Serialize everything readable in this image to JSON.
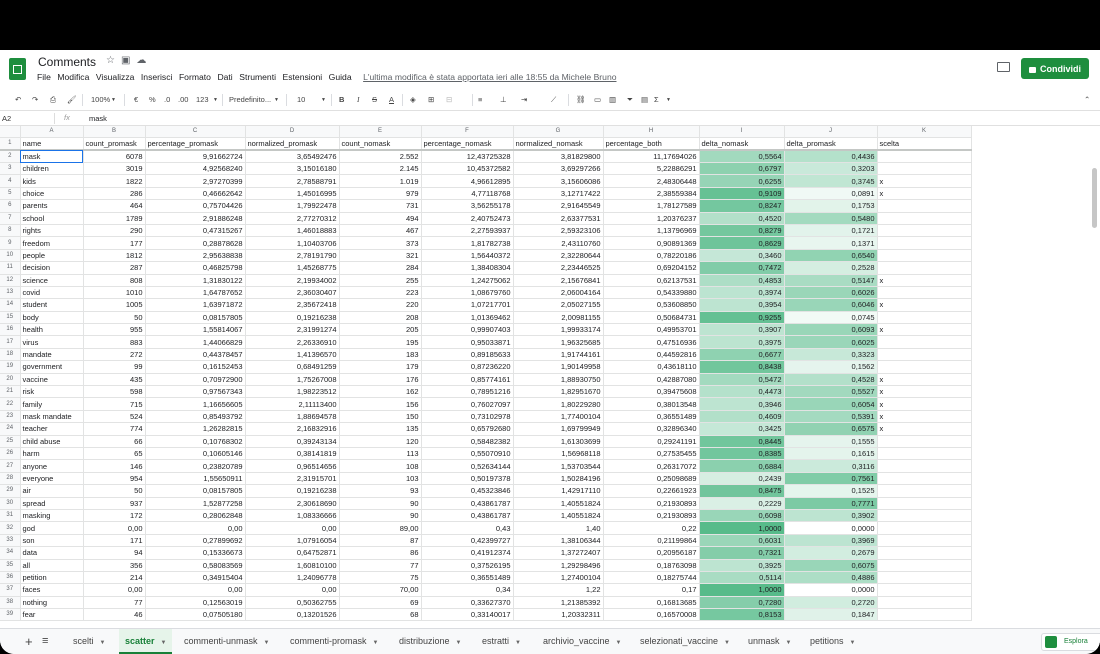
{
  "header": {
    "title": "Comments",
    "menus": [
      "File",
      "Modifica",
      "Visualizza",
      "Inserisci",
      "Formato",
      "Dati",
      "Strumenti",
      "Estensioni",
      "Guida"
    ],
    "last_edit": "L'ultima modifica è stata apportata ieri alle 18:55 da Michele Bruno",
    "share_label": "Condividi"
  },
  "toolbar": {
    "zoom": "100%",
    "currency": "€",
    "percent": "%",
    "dec_less": ".0",
    "dec_more": ".00",
    "format_more": "123",
    "font": "Predefinito...",
    "font_size": "10",
    "bold": "B",
    "italic": "I",
    "strike": "S",
    "text_color": "A",
    "sum": "Σ"
  },
  "formula_bar": {
    "cell_ref": "A2",
    "fx": "fx",
    "value": "mask"
  },
  "columns": [
    "",
    "A",
    "B",
    "C",
    "D",
    "E",
    "F",
    "G",
    "H",
    "I",
    "J",
    "K"
  ],
  "rows": [
    [
      "name",
      "count_promask",
      "percentage_promask",
      "normalized_promask",
      "count_nomask",
      "percentage_nomask",
      "normalized_nomask",
      "percentage_both",
      "delta_nomask",
      "delta_promask",
      "scelta"
    ],
    [
      "mask",
      "6078",
      "9,91662724",
      "3,65492476",
      "2.552",
      "12,43725328",
      "3,81829800",
      "11,17694026",
      "0,5564",
      "0,4436",
      ""
    ],
    [
      "children",
      "3019",
      "4,92568240",
      "3,15016180",
      "2.145",
      "10,45372582",
      "3,69297266",
      "5,22886291",
      "0,6797",
      "0,3203",
      ""
    ],
    [
      "kids",
      "1822",
      "2,97270399",
      "2,78588791",
      "1.019",
      "4,96612895",
      "3,15606086",
      "2,48306448",
      "0,6255",
      "0,3745",
      "x"
    ],
    [
      "choice",
      "286",
      "0,46662642",
      "1,45016995",
      "979",
      "4,77118768",
      "3,12717422",
      "2,38559384",
      "0,9109",
      "0,0891",
      "x"
    ],
    [
      "parents",
      "464",
      "0,75704426",
      "1,79922478",
      "731",
      "3,56255178",
      "2,91645549",
      "1,78127589",
      "0,8247",
      "0,1753",
      ""
    ],
    [
      "school",
      "1789",
      "2,91886248",
      "2,77270312",
      "494",
      "2,40752473",
      "2,63377531",
      "1,20376237",
      "0,4520",
      "0,5480",
      ""
    ],
    [
      "rights",
      "290",
      "0,47315267",
      "1,46018883",
      "467",
      "2,27593937",
      "2,59323106",
      "1,13796969",
      "0,8279",
      "0,1721",
      ""
    ],
    [
      "freedom",
      "177",
      "0,28878628",
      "1,10403706",
      "373",
      "1,81782738",
      "2,43110760",
      "0,90891369",
      "0,8629",
      "0,1371",
      ""
    ],
    [
      "people",
      "1812",
      "2,95638838",
      "2,78191790",
      "321",
      "1,56440372",
      "2,32280644",
      "0,78220186",
      "0,3460",
      "0,6540",
      ""
    ],
    [
      "decision",
      "287",
      "0,46825798",
      "1,45268775",
      "284",
      "1,38408304",
      "2,23446525",
      "0,69204152",
      "0,7472",
      "0,2528",
      ""
    ],
    [
      "science",
      "808",
      "1,31830122",
      "2,19934002",
      "255",
      "1,24275062",
      "2,15676841",
      "0,62137531",
      "0,4853",
      "0,5147",
      "x"
    ],
    [
      "covid",
      "1010",
      "1,64787652",
      "2,36030407",
      "223",
      "1,08679760",
      "2,06004164",
      "0,54339880",
      "0,3974",
      "0,6026",
      ""
    ],
    [
      "student",
      "1005",
      "1,63971872",
      "2,35672418",
      "220",
      "1,07217701",
      "2,05027155",
      "0,53608850",
      "0,3954",
      "0,6046",
      "x"
    ],
    [
      "body",
      "50",
      "0,08157805",
      "0,19216238",
      "208",
      "1,01369462",
      "2,00981155",
      "0,50684731",
      "0,9255",
      "0,0745",
      ""
    ],
    [
      "health",
      "955",
      "1,55814067",
      "2,31991274",
      "205",
      "0,99907403",
      "1,99933174",
      "0,49953701",
      "0,3907",
      "0,6093",
      "x"
    ],
    [
      "virus",
      "883",
      "1,44066829",
      "2,26336910",
      "195",
      "0,95033871",
      "1,96325685",
      "0,47516936",
      "0,3975",
      "0,6025",
      ""
    ],
    [
      "mandate",
      "272",
      "0,44378457",
      "1,41396570",
      "183",
      "0,89185633",
      "1,91744161",
      "0,44592816",
      "0,6677",
      "0,3323",
      ""
    ],
    [
      "government",
      "99",
      "0,16152453",
      "0,68491259",
      "179",
      "0,87236220",
      "1,90149958",
      "0,43618110",
      "0,8438",
      "0,1562",
      ""
    ],
    [
      "vaccine",
      "435",
      "0,70972900",
      "1,75267008",
      "176",
      "0,85774161",
      "1,88930750",
      "0,42887080",
      "0,5472",
      "0,4528",
      "x"
    ],
    [
      "risk",
      "598",
      "0,97567343",
      "1,98223512",
      "162",
      "0,78951216",
      "1,82951670",
      "0,39475608",
      "0,4473",
      "0,5527",
      "x"
    ],
    [
      "family",
      "715",
      "1,16656605",
      "2,11113400",
      "156",
      "0,76027097",
      "1,80229280",
      "0,38013548",
      "0,3946",
      "0,6054",
      "x"
    ],
    [
      "mask mandate",
      "524",
      "0,85493792",
      "1,88694578",
      "150",
      "0,73102978",
      "1,77400104",
      "0,36551489",
      "0,4609",
      "0,5391",
      "x"
    ],
    [
      "teacher",
      "774",
      "1,26282815",
      "2,16832916",
      "135",
      "0,65792680",
      "1,69799949",
      "0,32896340",
      "0,3425",
      "0,6575",
      "x"
    ],
    [
      "child abuse",
      "66",
      "0,10768302",
      "0,39243134",
      "120",
      "0,58482382",
      "1,61303699",
      "0,29241191",
      "0,8445",
      "0,1555",
      ""
    ],
    [
      "harm",
      "65",
      "0,10605146",
      "0,38141819",
      "113",
      "0,55070910",
      "1,56968118",
      "0,27535455",
      "0,8385",
      "0,1615",
      ""
    ],
    [
      "anyone",
      "146",
      "0,23820789",
      "0,96514656",
      "108",
      "0,52634144",
      "1,53703544",
      "0,26317072",
      "0,6884",
      "0,3116",
      ""
    ],
    [
      "everyone",
      "954",
      "1,55650911",
      "2,31915701",
      "103",
      "0,50197378",
      "1,50284196",
      "0,25098689",
      "0,2439",
      "0,7561",
      ""
    ],
    [
      "air",
      "50",
      "0,08157805",
      "0,19216238",
      "93",
      "0,45323846",
      "1,42917110",
      "0,22661923",
      "0,8475",
      "0,1525",
      ""
    ],
    [
      "spread",
      "937",
      "1,52877258",
      "2,30618690",
      "90",
      "0,43861787",
      "1,40551824",
      "0,21930893",
      "0,2229",
      "0,7771",
      ""
    ],
    [
      "masking",
      "172",
      "0,28062848",
      "1,08336666",
      "90",
      "0,43861787",
      "1,40551824",
      "0,21930893",
      "0,6098",
      "0,3902",
      ""
    ],
    [
      "god",
      "0,00",
      "0,00",
      "0,00",
      "89,00",
      "0,43",
      "1,40",
      "0,22",
      "1,0000",
      "0,0000",
      ""
    ],
    [
      "son",
      "171",
      "0,27899692",
      "1,07916054",
      "87",
      "0,42399727",
      "1,38106344",
      "0,21199864",
      "0,6031",
      "0,3969",
      ""
    ],
    [
      "data",
      "94",
      "0,15336673",
      "0,64752871",
      "86",
      "0,41912374",
      "1,37272407",
      "0,20956187",
      "0,7321",
      "0,2679",
      ""
    ],
    [
      "all",
      "356",
      "0,58083569",
      "1,60810100",
      "77",
      "0,37526195",
      "1,29298496",
      "0,18763098",
      "0,3925",
      "0,6075",
      ""
    ],
    [
      "petition",
      "214",
      "0,34915404",
      "1,24096778",
      "75",
      "0,36551489",
      "1,27400104",
      "0,18275744",
      "0,5114",
      "0,4886",
      ""
    ],
    [
      "faces",
      "0,00",
      "0,00",
      "0,00",
      "70,00",
      "0,34",
      "1,22",
      "0,17",
      "1,0000",
      "0,0000",
      ""
    ],
    [
      "nothing",
      "77",
      "0,12563019",
      "0,50362755",
      "69",
      "0,33627370",
      "1,21385392",
      "0,16813685",
      "0,7280",
      "0,2720",
      ""
    ],
    [
      "fear",
      "46",
      "0,07505180",
      "0,13201526",
      "68",
      "0,33140017",
      "1,20332311",
      "0,16570008",
      "0,8153",
      "0,1847",
      ""
    ]
  ],
  "colors": {
    "brand": "#1e8e3e",
    "scale_low": "#ffffff",
    "scale_high": "#57bb8a"
  },
  "sheet_tabs": [
    "scelti",
    "scatter",
    "commenti-unmask",
    "commenti-promask",
    "distribuzione",
    "estratti",
    "archivio_vaccine",
    "selezionati_vaccine",
    "unmask",
    "petitions"
  ],
  "active_tab": "scatter",
  "explore_label": "Esplora"
}
